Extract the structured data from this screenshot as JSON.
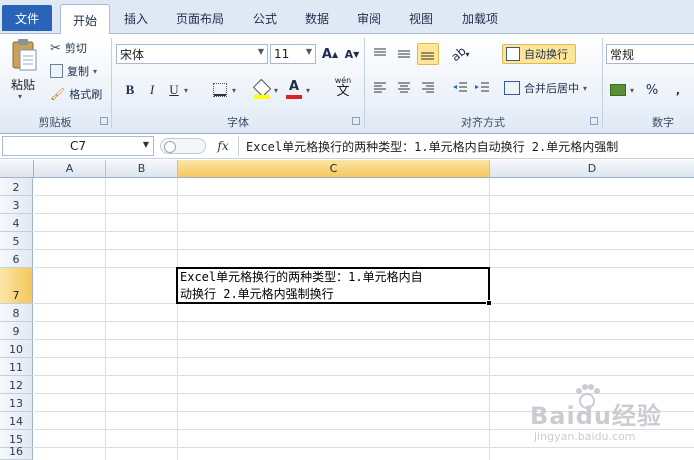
{
  "tabs": [
    "文件",
    "开始",
    "插入",
    "页面布局",
    "公式",
    "数据",
    "审阅",
    "视图",
    "加载项"
  ],
  "clipboard": {
    "paste": "粘贴",
    "cut": "剪切",
    "copy": "复制",
    "format_painter": "格式刷",
    "group": "剪贴板"
  },
  "font": {
    "name": "宋体",
    "size": "11",
    "grow": "A",
    "shrink": "A",
    "bold": "B",
    "italic": "I",
    "underline": "U",
    "wen": "wén",
    "wen_char": "文",
    "font_color_char": "A",
    "group": "字体"
  },
  "alignment": {
    "wrap_text": "自动换行",
    "merge_center": "合并后居中",
    "group": "对齐方式"
  },
  "number": {
    "format": "常规",
    "percent": "%",
    "group": "数字"
  },
  "formula_bar": {
    "name_box": "C7",
    "fx": "fx",
    "content": "Excel单元格换行的两种类型：1.单元格内自动换行 2.单元格内强制"
  },
  "columns": [
    "A",
    "B",
    "C",
    "D"
  ],
  "rows": [
    "2",
    "3",
    "4",
    "5",
    "6",
    "7",
    "8",
    "9",
    "10",
    "11",
    "12",
    "13",
    "14",
    "15",
    "16"
  ],
  "cell_c7": {
    "line1": "Excel单元格换行的两种类型：1.单元格内自",
    "line2": "动换行 2.单元格内强制换行"
  },
  "watermark": {
    "brand": "Baidu经验",
    "url": "jingyan.baidu.com"
  },
  "colors": {
    "file_tab": "#2a64b9",
    "selected_header": "#f4c75a",
    "ribbon_bg": "#dfe9f5"
  }
}
